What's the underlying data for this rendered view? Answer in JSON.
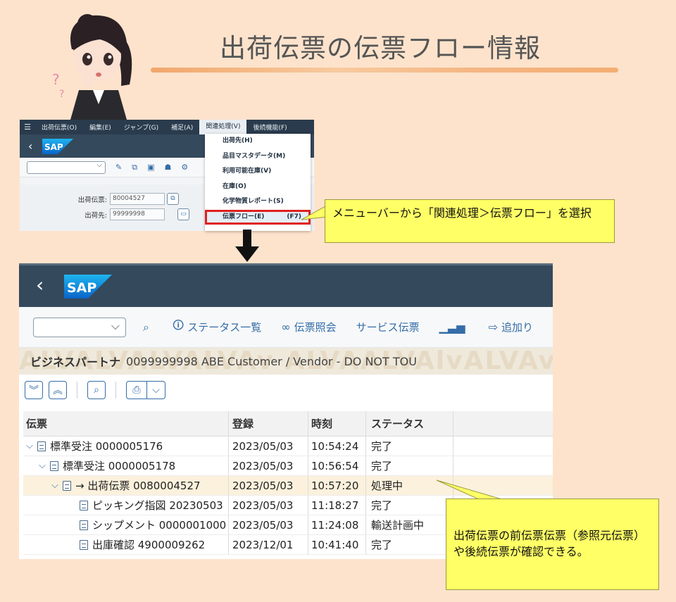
{
  "title": "出荷伝票の伝票フロー情報",
  "small_screen": {
    "menu": [
      "出荷伝票(O)",
      "編集(E)",
      "ジャンプ(G)",
      "補足(A)",
      "関連処理(V)",
      "後続機能(F)"
    ],
    "active_menu_index": 4,
    "form": {
      "delivery_label": "出荷伝票:",
      "delivery_value": "80004527",
      "shipto_label": "出荷先:",
      "shipto_value": "99999998"
    },
    "dropdown": {
      "items": [
        "出荷先(H)",
        "品目マスタデータ(M)",
        "利用可能在庫(V)",
        "在庫(O)",
        "化学物質レポート(S)"
      ],
      "highlighted_label": "伝票フロー(E)",
      "highlighted_shortcut": "(F7)"
    }
  },
  "callout1": "メニューバーから「関連処理＞伝票フロー」を選択",
  "big_screen": {
    "toolbar": {
      "status_overview": "ステータス一覧",
      "doc_display": "伝票照会",
      "service_doc": "サービス伝票",
      "add": "追加り"
    },
    "partner": {
      "label": "ビジネスパートナ",
      "value": "0099999998 ABE Customer / Vendor - DO NOT TOU",
      "watermark": "ALVALVALVALVAv ALVAALVAlvALVAvALV"
    },
    "table": {
      "headers": [
        "伝票",
        "登録",
        "時刻",
        "ステータス"
      ],
      "rows": [
        {
          "doc": "標準受注 0000005176",
          "date": "2023/05/03",
          "time": "10:54:24",
          "status": "完了"
        },
        {
          "doc": "標準受注 0000005178",
          "date": "2023/05/03",
          "time": "10:56:54",
          "status": "完了"
        },
        {
          "doc": "→ 出荷伝票 0080004527",
          "date": "2023/05/03",
          "time": "10:57:20",
          "status": "処理中"
        },
        {
          "doc": "ピッキング指図 20230503",
          "date": "2023/05/03",
          "time": "11:18:27",
          "status": "完了"
        },
        {
          "doc": "シップメント 0000001000",
          "date": "2023/05/03",
          "time": "11:24:08",
          "status": "輸送計画中"
        },
        {
          "doc": "出庫確認 4900009262",
          "date": "2023/12/01",
          "time": "10:41:40",
          "status": "完了"
        }
      ]
    }
  },
  "callout2": "出荷伝票の前伝票伝票（参照元伝票）や後続伝票が確認できる。"
}
